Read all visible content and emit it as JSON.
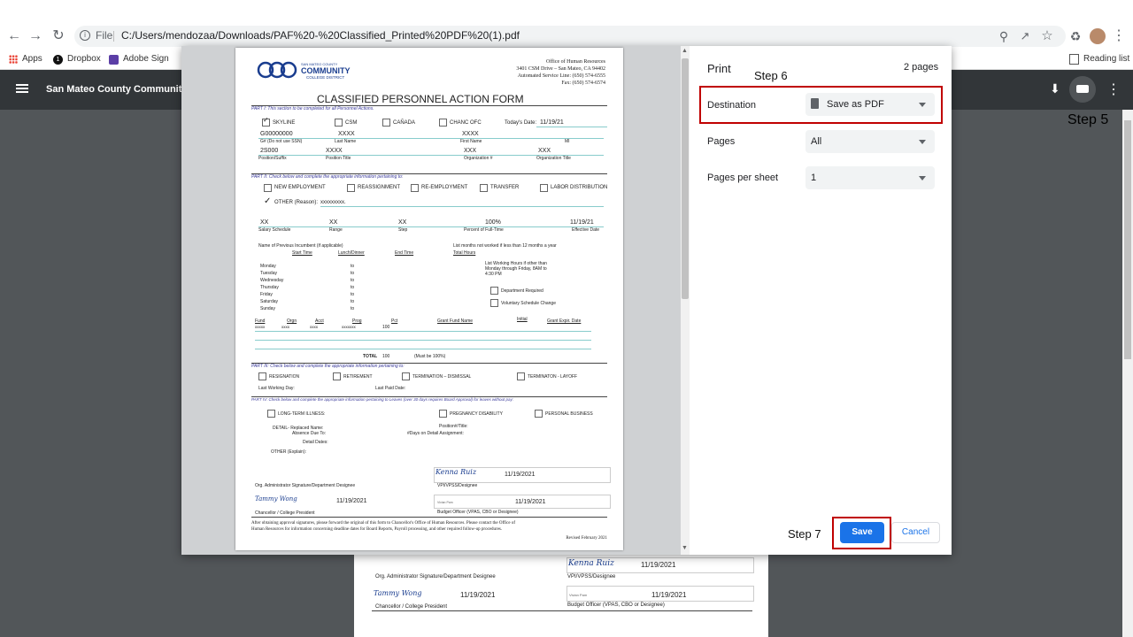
{
  "browser": {
    "address_prefix": "File",
    "url": "C:/Users/mendozaa/Downloads/PAF%20-%20Classified_Printed%20PDF%20(1).pdf",
    "bookmarks": [
      "Apps",
      "Dropbox",
      "Adobe Sign"
    ],
    "reading_list": "Reading list"
  },
  "pdf_viewer": {
    "title": "San Mateo County Community C"
  },
  "print_dialog": {
    "title": "Print",
    "page_count": "2 pages",
    "destination_label": "Destination",
    "destination_value": "Save as PDF",
    "pages_label": "Pages",
    "pages_value": "All",
    "pages_per_sheet_label": "Pages per sheet",
    "pages_per_sheet_value": "1",
    "save_label": "Save",
    "cancel_label": "Cancel"
  },
  "annotations": {
    "step5": "Step 5",
    "step6": "Step 6",
    "step7": "Step 7"
  },
  "form": {
    "logo_line1": "SAN MATEO COUNTY",
    "logo_line2": "COMMUNITY",
    "logo_line3": "COLLEGE DISTRICT",
    "office": "Office of Human Resources",
    "address": "3401 CSM Drive – San Mateo, CA 94402",
    "service_line": "Automated Service Line: (650) 574-6555",
    "fax": "Fax: (650) 574-6574",
    "title": "CLASSIFIED PERSONNEL ACTION FORM",
    "part1": "PART I: This section to be completed for all Personnel Actions.",
    "skyline": "SKYLINE",
    "csm": "CSM",
    "canada": "CAÑADA",
    "chanc": "CHANC OFC",
    "todays_date_label": "Today's Date:",
    "todays_date": "11/19/21",
    "g_number": "G00000000",
    "last_name_val": "XXXX",
    "first_name_val": "XXXX",
    "g_label": "G# (Do not use SSN)",
    "last_name_label": "Last Name",
    "first_name_label": "First Name",
    "mi_label": "MI",
    "position": "2S000",
    "position_title_val": "XXXX",
    "org_val": "XXX",
    "org_title_val": "XXX",
    "position_label": "Position/Suffix",
    "position_title_label": "Position Title",
    "org_label": "Organization #",
    "org_title_label": "Organization Title",
    "part2": "PART II: Check below and complete the appropriate information pertaining to:",
    "new_employment": "NEW EMPLOYMENT",
    "reassignment": "REASSIGNMENT",
    "re_employment": "RE-EMPLOYMENT",
    "transfer": "TRANSFER",
    "labor": "LABOR  DISTRIBUTION",
    "other_reason": "OTHER (Reason):",
    "other_val": "xxxxxxxxx.",
    "salary_val": "XX",
    "range_val": "XX",
    "step_val": "XX",
    "percent_val": "100%",
    "effective_val": "11/19/21",
    "salary_label": "Salary Schedule",
    "range_label": "Range",
    "step_label": "Step",
    "percent_label": "Percent of Full-Time",
    "effective_label": "Effective Date",
    "prev_incumbent": "Name of Previous Incumbent (if applicable)",
    "months_not_worked": "List months not worked if less than 12 months a year",
    "start_time": "Start Time",
    "lunch": "Lunch/Dinner",
    "end_time": "End Time",
    "total_hours": "Total Hours",
    "days": [
      "Monday",
      "Tuesday",
      "Wednesday",
      "Thursday",
      "Friday",
      "Saturday",
      "Sunday"
    ],
    "to": "to",
    "list_hours": "List Working Hours if other than",
    "list_hours2": "Monday through Friday, 8AM to",
    "list_hours3": "4:30 PM",
    "dept_required": "Department Required",
    "voluntary": "Voluntary Schedule Change",
    "fund": "Fund",
    "orgn": "Orgn",
    "acct": "Acct",
    "prog": "Prog",
    "pct": "Pct",
    "grant_fund": "Grant Fund Name",
    "initial": "Initial",
    "grant_expir": "Grant Expir. Date",
    "fund_val": "xxxxx",
    "orgn_val": "xxxx",
    "acct_val": "xxxx",
    "prog_val": "xxxxxxx",
    "pct_val": "100",
    "total_label": "TOTAL",
    "total_val": "100",
    "must_be": "(Must be 100%)",
    "part3": "PART III: Check below and complete the appropriate information pertaining to:",
    "resignation": "RESIGNATION",
    "retirement": "RETIREMENT",
    "term_dismissal": "TERMINATION – DISMISSAL",
    "term_layoff": "TERMINATON - LAYOFF",
    "last_working": "Last Working Day:",
    "last_paid": "Last Paid Date:",
    "part4": "PART IV: Check below and complete the appropriate information pertaining to Leaves (over 30 days requires Board Approval) for leaves without pay:",
    "long_term": "LONG-TERM ILLNESS:",
    "pregnancy": "PREGNANCY DISABILITY",
    "personal": "PERSONAL BUSINESS",
    "detail_replaced": "DETAIL- Replaced Name:",
    "absence_due": "Absence Due To:",
    "detail_dates": "Detail Dates:",
    "other_explain": "OTHER (Explain):",
    "position_title2": "Position#/Title:",
    "days_on_detail": "#Days on Detail Assignment:",
    "sig1": "Kenna Ruiz",
    "date1": "11/19/2021",
    "org_admin": "Org. Administrator Signature/Department Designee",
    "vpi": "VPI/VPSS/Designee",
    "sig2": "Tammy Wong",
    "date2": "11/19/2021",
    "sig3_label": "Vivian Pam",
    "date3": "11/19/2021",
    "chancellor": "Chancellor / College President",
    "budget": "Budget Officer (VPAS, CBO or Designee)",
    "footer": "After obtaining approval signatures, please forward the original of this form to Chancellor's Office of Human Resources. Please contact the Office of",
    "footer2": "Human Resources for information concerning deadline dates for Board Reports, Payroll processing, and other required follow-up procedures.",
    "revised": "Revised February 2021"
  }
}
